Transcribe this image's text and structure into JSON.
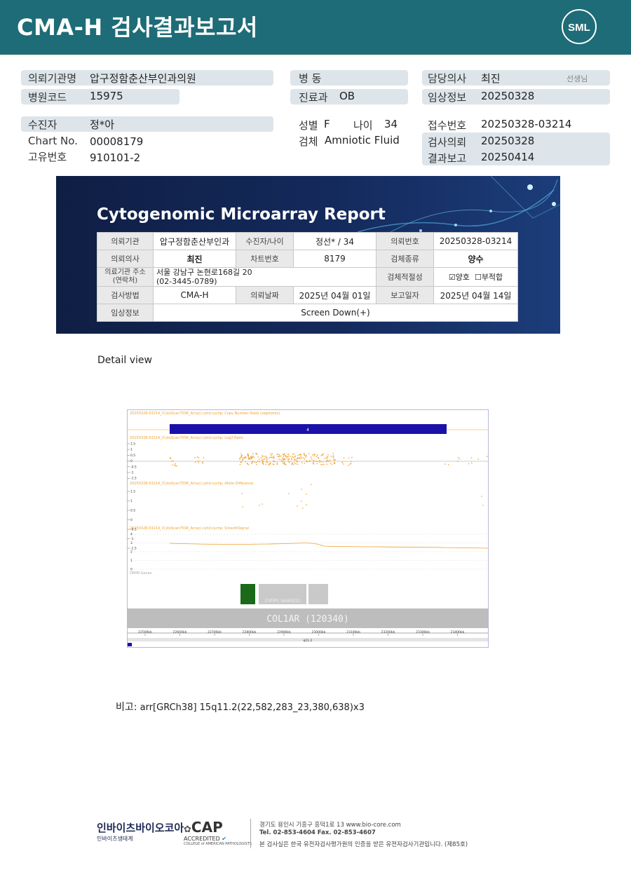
{
  "header": {
    "title": "CMA-H 검사결과보고서",
    "logo_text": "SML"
  },
  "info": {
    "req_org_label": "의뢰기관명",
    "req_org_value": "압구정함춘산부인과의원",
    "hosp_code_label": "병원코드",
    "hosp_code_value": "15975",
    "ward_label": "병 동",
    "ward_value": "",
    "dept_label": "진료과",
    "dept_value": "OB",
    "doctor_label": "담당의사",
    "doctor_value": "최진",
    "doctor_suffix": "선생님",
    "clinical_label": "임상정보",
    "clinical_value": "20250328",
    "patient_label": "수진자",
    "patient_value": "정*아",
    "chart_label": "Chart No.",
    "chart_value": "00008179",
    "uid_label": "고유번호",
    "uid_value": "910101-2",
    "sex_label": "성별",
    "sex_value": "F",
    "age_label": "나이",
    "age_value": "34",
    "specimen_label": "검체",
    "specimen_value": "Amniotic Fluid",
    "accession_label": "접수번호",
    "accession_value": "20250328-03214",
    "request_label": "검사의뢰",
    "request_value": "20250328",
    "report_label": "결과보고",
    "report_value": "20250414"
  },
  "report": {
    "title": "Cytogenomic Microarray Report",
    "r1": [
      "의뢰기관",
      "압구정함춘산부인과",
      "수진자/나이",
      "정선* / 34",
      "의뢰번호",
      "20250328-03214"
    ],
    "r2": [
      "의뢰의사",
      "최진",
      "차트번호",
      "8179",
      "검체종류",
      "양수"
    ],
    "r3_label": "의료기관 주소\n(연락처)",
    "r3_addr": "서울 강남구 논현로168길 20",
    "r3_tel": "(02-3445-0789)",
    "r3_spec_label": "검체적절성",
    "r3_ok": "양호",
    "r3_bad": "부적합",
    "r4": [
      "검사방법",
      "CMA-H",
      "의뢰날짜",
      "2025년 04월 01일",
      "보고일자",
      "2025년 04월 14일"
    ],
    "r5": [
      "임상정보",
      "Screen Down(+)"
    ]
  },
  "detail_label": "Detail view",
  "plot": {
    "track1": "20250328-03214_(CytoScan750K_Array).cyhd.cychp: Copy Number State (segments)",
    "track2": "20250328-03214_(CytoScan750K_Array).cyhd.cychp: Log2 Ratio",
    "track3": "20250328-03214_(CytoScan750K_Array).cyhd.cychp: Allele Difference",
    "track4": "20250328-03214_(CytoScan750K_Array).cyhd.cychp: SmoothSignal",
    "segment_label": "4",
    "omim_label": "OMIM Genes",
    "gene1": "CYFIP1 (606322)",
    "gene_main": "COL1AR (120340)",
    "axis_ticks": [
      "22500kb",
      "22600kb",
      "22700kb",
      "22800kb",
      "22900kb",
      "23000kb",
      "23100kb",
      "23200kb",
      "23300kb",
      "23400kb"
    ],
    "band": "q11.2",
    "log2_ticks": [
      "1.5",
      "1",
      "0.5",
      "0",
      "-0.5",
      "-1",
      "-1.5"
    ],
    "ad_ticks": [
      "1.5",
      "1",
      "0.5",
      "0",
      "-0.5",
      "-1",
      "-1.5"
    ],
    "ss_ticks": [
      "4",
      "3",
      "2",
      "1",
      "0"
    ]
  },
  "note": {
    "label": "비고:",
    "value": "arr[GRCh38] 15q11.2(22,582,283_23,380,638)x3"
  },
  "footer": {
    "company": "인바이츠바이오코아",
    "company_sub": "인바이츠생태계",
    "cap": "CAP",
    "cap_sub": "ACCREDITED",
    "cap_small": "COLLEGE of AMERICAN PATHOLOGISTS",
    "addr": "경기도 용인시 기흥구 흥덕1로 13   www.bio-core.com",
    "tel": "Tel. 02-853-4604   Fax. 02-853-4607",
    "cert": "본 검사실은 한국 유전자검사평가원의 인증을 받은 유전자검사기관입니다. (제85호)"
  }
}
